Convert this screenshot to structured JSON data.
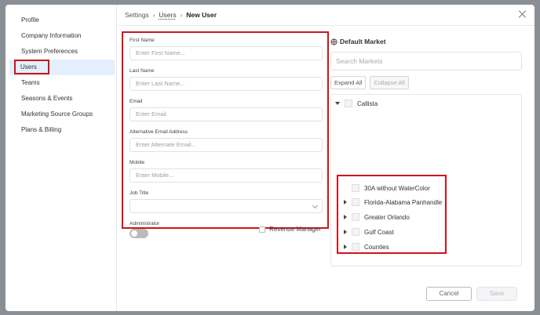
{
  "sidebar": {
    "items": [
      {
        "label": "Profile"
      },
      {
        "label": "Company Information"
      },
      {
        "label": "System Preferences"
      },
      {
        "label": "Users"
      },
      {
        "label": "Teams"
      },
      {
        "label": "Seasons & Events"
      },
      {
        "label": "Marketing Source Groups"
      },
      {
        "label": "Plans & Billing"
      }
    ]
  },
  "breadcrumb": {
    "root": "Settings",
    "parent": "Users",
    "current": "New User"
  },
  "form": {
    "first_name": {
      "label": "First Name",
      "placeholder": "Enter First Name..."
    },
    "last_name": {
      "label": "Last Name",
      "placeholder": "Enter Last Name..."
    },
    "email": {
      "label": "Email",
      "placeholder": "Enter Email"
    },
    "alt_email": {
      "label": "Alternative Email Address",
      "placeholder": "Enter Alternate Email..."
    },
    "mobile": {
      "label": "Mobile",
      "placeholder": "Enter Mobile..."
    },
    "job_title": {
      "label": "Job Title",
      "value": ""
    },
    "administrator": {
      "label": "Administrator"
    },
    "revenue_manager": {
      "label": "Revenue Manager"
    }
  },
  "market": {
    "title": "Default Market",
    "search_placeholder": "Search Markets",
    "expand_all": "Expand All",
    "collapse_all": "Collapse All",
    "root": "Callista",
    "children": [
      {
        "label": "30A without WaterColor",
        "expandable": false
      },
      {
        "label": "Florida-Alabama Panhandle",
        "expandable": true
      },
      {
        "label": "Greater Orlando",
        "expandable": true
      },
      {
        "label": "Gulf Coast",
        "expandable": true
      },
      {
        "label": "Counties",
        "expandable": true
      }
    ]
  },
  "footer": {
    "cancel": "Cancel",
    "save": "Save"
  },
  "colors": {
    "highlight": "#d0121b",
    "active_nav": "#e3effd"
  }
}
